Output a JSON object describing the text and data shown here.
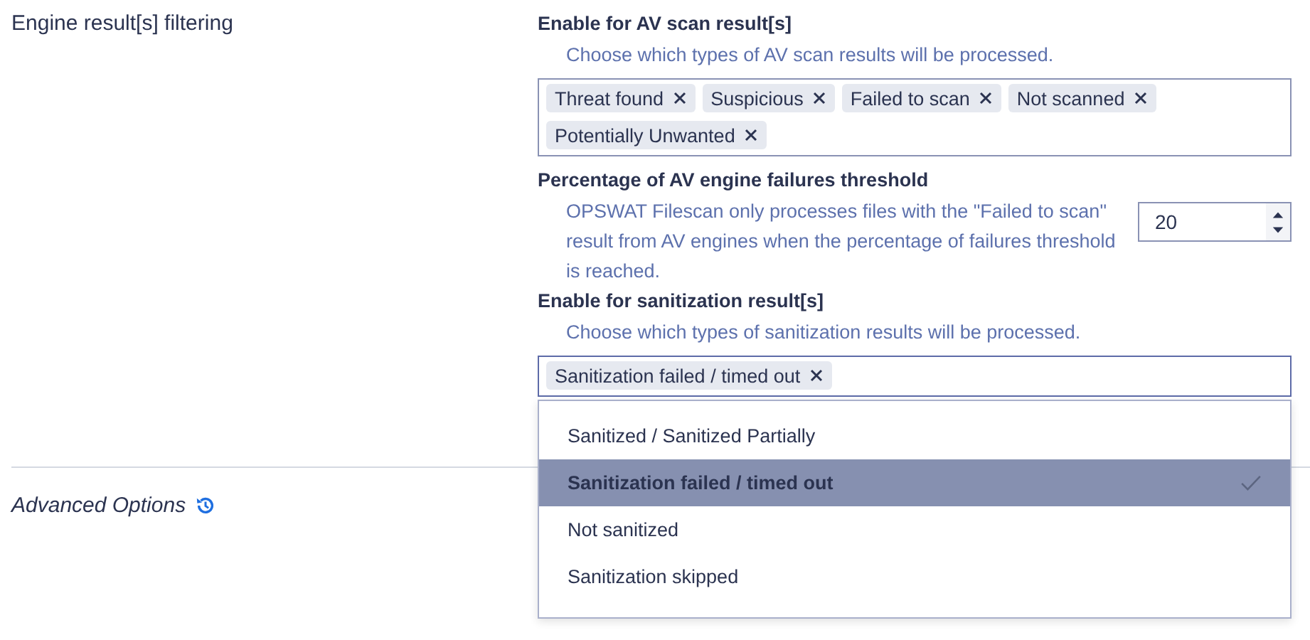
{
  "section_title": "Engine result[s] filtering",
  "av_scan": {
    "label": "Enable for AV scan result[s]",
    "description": "Choose which types of AV scan results will be processed.",
    "tags": [
      "Threat found",
      "Suspicious",
      "Failed to scan",
      "Not scanned",
      "Potentially Unwanted"
    ]
  },
  "threshold": {
    "label": "Percentage of AV engine failures threshold",
    "description": "OPSWAT Filescan only processes files with the \"Failed to scan\" result from AV engines when the percentage of failures threshold is reached.",
    "value": "20"
  },
  "sanitization": {
    "label": "Enable for sanitization result[s]",
    "description": "Choose which types of sanitization results will be processed.",
    "tags": [
      "Sanitization failed / timed out"
    ],
    "options": [
      {
        "label": "Sanitized / Sanitized Partially",
        "selected": false
      },
      {
        "label": "Sanitization failed / timed out",
        "selected": true
      },
      {
        "label": "Not sanitized",
        "selected": false
      },
      {
        "label": "Sanitization skipped",
        "selected": false
      }
    ]
  },
  "advanced": {
    "title": "Advanced Options"
  }
}
